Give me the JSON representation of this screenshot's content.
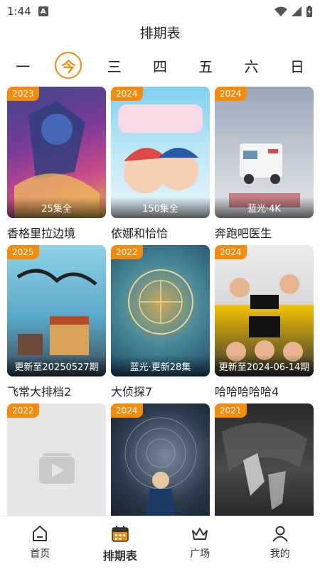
{
  "status_bar": {
    "time": "1:44",
    "a_icon": "A"
  },
  "page_title": "排期表",
  "weekdays": [
    {
      "label": "一",
      "active": false
    },
    {
      "label": "今",
      "active": true
    },
    {
      "label": "三",
      "active": false
    },
    {
      "label": "四",
      "active": false
    },
    {
      "label": "五",
      "active": false
    },
    {
      "label": "六",
      "active": false
    },
    {
      "label": "日",
      "active": false
    }
  ],
  "shows": [
    {
      "year": "2023",
      "status": "25集全",
      "title": "香格里拉边境"
    },
    {
      "year": "2024",
      "status": "150集全",
      "title": "依娜和恰恰"
    },
    {
      "year": "2024",
      "status": "蓝光·4K",
      "title": "奔跑吧医生"
    },
    {
      "year": "2025",
      "status": "更新至20250527期",
      "title": "飞常大排档2"
    },
    {
      "year": "2022",
      "status": "蓝光·更新28集",
      "title": "大侦探7"
    },
    {
      "year": "2024",
      "status": "更新至2024-06-14期",
      "title": "哈哈哈哈哈4"
    },
    {
      "year": "2022",
      "status": "",
      "title": ""
    },
    {
      "year": "2024",
      "status": "",
      "title": ""
    },
    {
      "year": "2021",
      "status": "",
      "title": ""
    }
  ],
  "tabs": [
    {
      "label": "首页",
      "icon": "home-icon",
      "active": false
    },
    {
      "label": "排期表",
      "icon": "calendar-icon",
      "active": true
    },
    {
      "label": "广场",
      "icon": "crown-icon",
      "active": false
    },
    {
      "label": "我的",
      "icon": "user-icon",
      "active": false
    }
  ],
  "colors": {
    "accent": "#f58b0a",
    "text": "#222222"
  }
}
